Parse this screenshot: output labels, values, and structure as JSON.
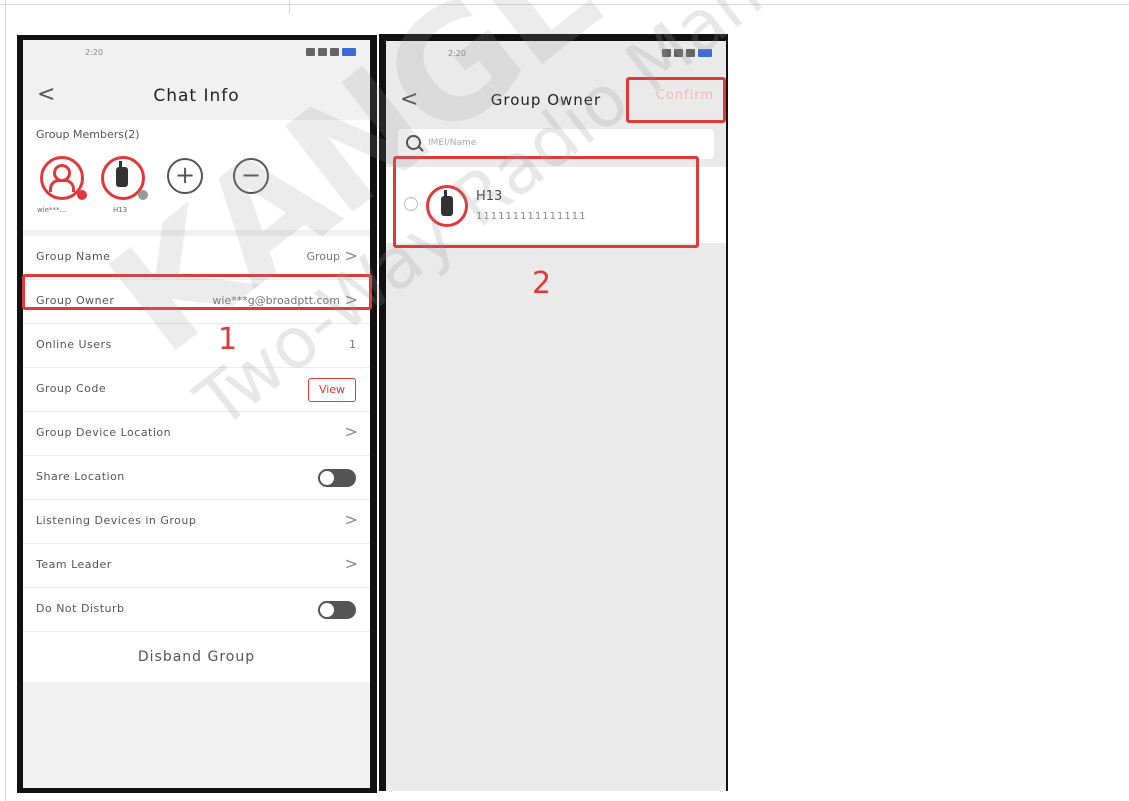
{
  "phone1": {
    "status_time": "2:20",
    "status_battery": "75%",
    "title": "Chat Info",
    "members_label": "Group Members(2)",
    "members": [
      {
        "name": "wie***..."
      },
      {
        "name": "H13"
      }
    ],
    "rows": {
      "group_name": {
        "label": "Group Name",
        "value": "Group"
      },
      "group_owner": {
        "label": "Group Owner",
        "value": "wie***g@broadptt.com"
      },
      "online_users": {
        "label": "Online Users",
        "value": "1"
      },
      "group_code": {
        "label": "Group Code",
        "button": "View"
      },
      "group_device_location": {
        "label": "Group Device Location"
      },
      "share_location": {
        "label": "Share Location"
      },
      "listening_devices": {
        "label": "Listening Devices in Group"
      },
      "team_leader": {
        "label": "Team Leader"
      },
      "do_not_disturb": {
        "label": "Do Not Disturb"
      }
    },
    "disband": "Disband Group",
    "step": "1"
  },
  "phone2": {
    "status_time": "2:20",
    "status_battery": "75%",
    "title": "Group Owner",
    "confirm": "Confirm",
    "search_placeholder": "IMEI/Name",
    "owner": {
      "name": "H13",
      "id": "111111111111111"
    },
    "step": "2"
  },
  "watermark": {
    "logo": "KANGLONG",
    "subtitle": "Two-Way Radio Manufacturer"
  },
  "colors": {
    "accent": "#e0393b",
    "toggle_off": "#555555",
    "confirm_disabled": "#f3b8b8"
  }
}
